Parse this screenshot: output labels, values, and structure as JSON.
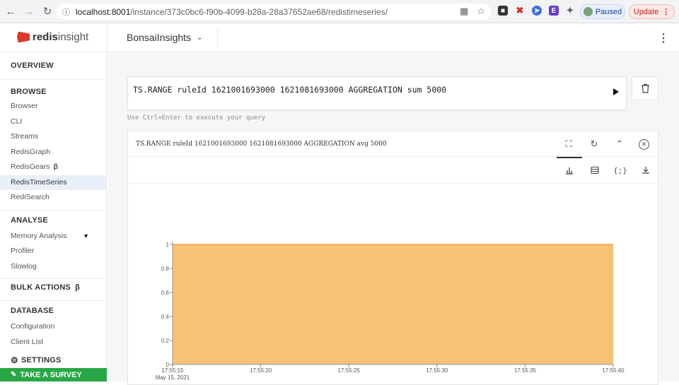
{
  "browser": {
    "url_host": "localhost:8001",
    "url_path": "/instance/373c0bc6-f90b-4099-b28a-28a37652ae68/redistimeseries/",
    "paused_label": "Paused",
    "update_label": "Update"
  },
  "app": {
    "logo_bold": "redis",
    "logo_rest": "insight",
    "database_name": "BonsaiInsights"
  },
  "sidebar": {
    "overview": "OVERVIEW",
    "browse": "BROWSE",
    "browse_items": [
      "Browser",
      "CLI",
      "Streams",
      "RedisGraph",
      "RedisGears",
      "RedisTimeSeries",
      "RediSearch"
    ],
    "beta_mark": "β",
    "analyse": "ANALYSE",
    "analyse_items": [
      "Memory Analysis",
      "Profiler",
      "Slowlog"
    ],
    "bulk_actions": "BULK ACTIONS",
    "database": "DATABASE",
    "database_items": [
      "Configuration",
      "Client List"
    ],
    "settings": "SETTINGS",
    "survey": "TAKE A SURVEY"
  },
  "query": {
    "text": "TS.RANGE ruleId 1621001693000 1621081693000 AGGREGATION sum 5000",
    "hint": "Use Ctrl+Enter to execute your query"
  },
  "result": {
    "query": "TS.RANGE ruleId 1621001693000 1621081693000 AGGREGATION avg 5000"
  },
  "chart_data": {
    "type": "area",
    "x": [
      "17:55:15",
      "17:55:20",
      "17:55:25",
      "17:55:30",
      "17:55:35",
      "17:55:40"
    ],
    "date_label": "May 15, 2021",
    "values": [
      1,
      1,
      1,
      1,
      1,
      1
    ],
    "y_ticks": [
      "0",
      "0.2",
      "0.4",
      "0.6",
      "0.8",
      "1"
    ],
    "ylim": [
      0,
      1
    ],
    "fill_color": "#f5bf6e",
    "line_color": "#f0a63a"
  }
}
